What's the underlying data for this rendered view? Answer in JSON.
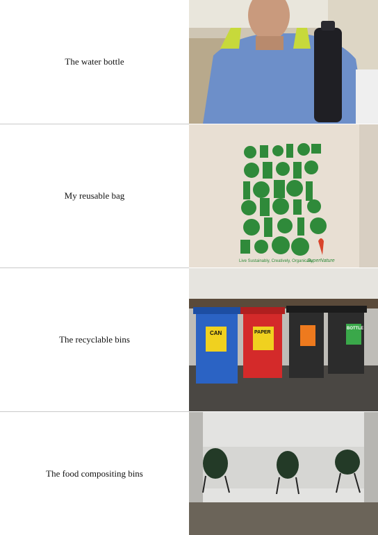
{
  "rows": [
    {
      "caption": "The water bottle"
    },
    {
      "caption": "My reusable bag",
      "bag_text_left": "Live Sustainably, Creatively, Organically",
      "bag_text_right": "SuperNature"
    },
    {
      "caption": "The recyclable bins",
      "bin_labels": [
        "CAN",
        "PAPER",
        "",
        "BOTTLE"
      ]
    },
    {
      "caption": "The food compositing bins"
    }
  ]
}
